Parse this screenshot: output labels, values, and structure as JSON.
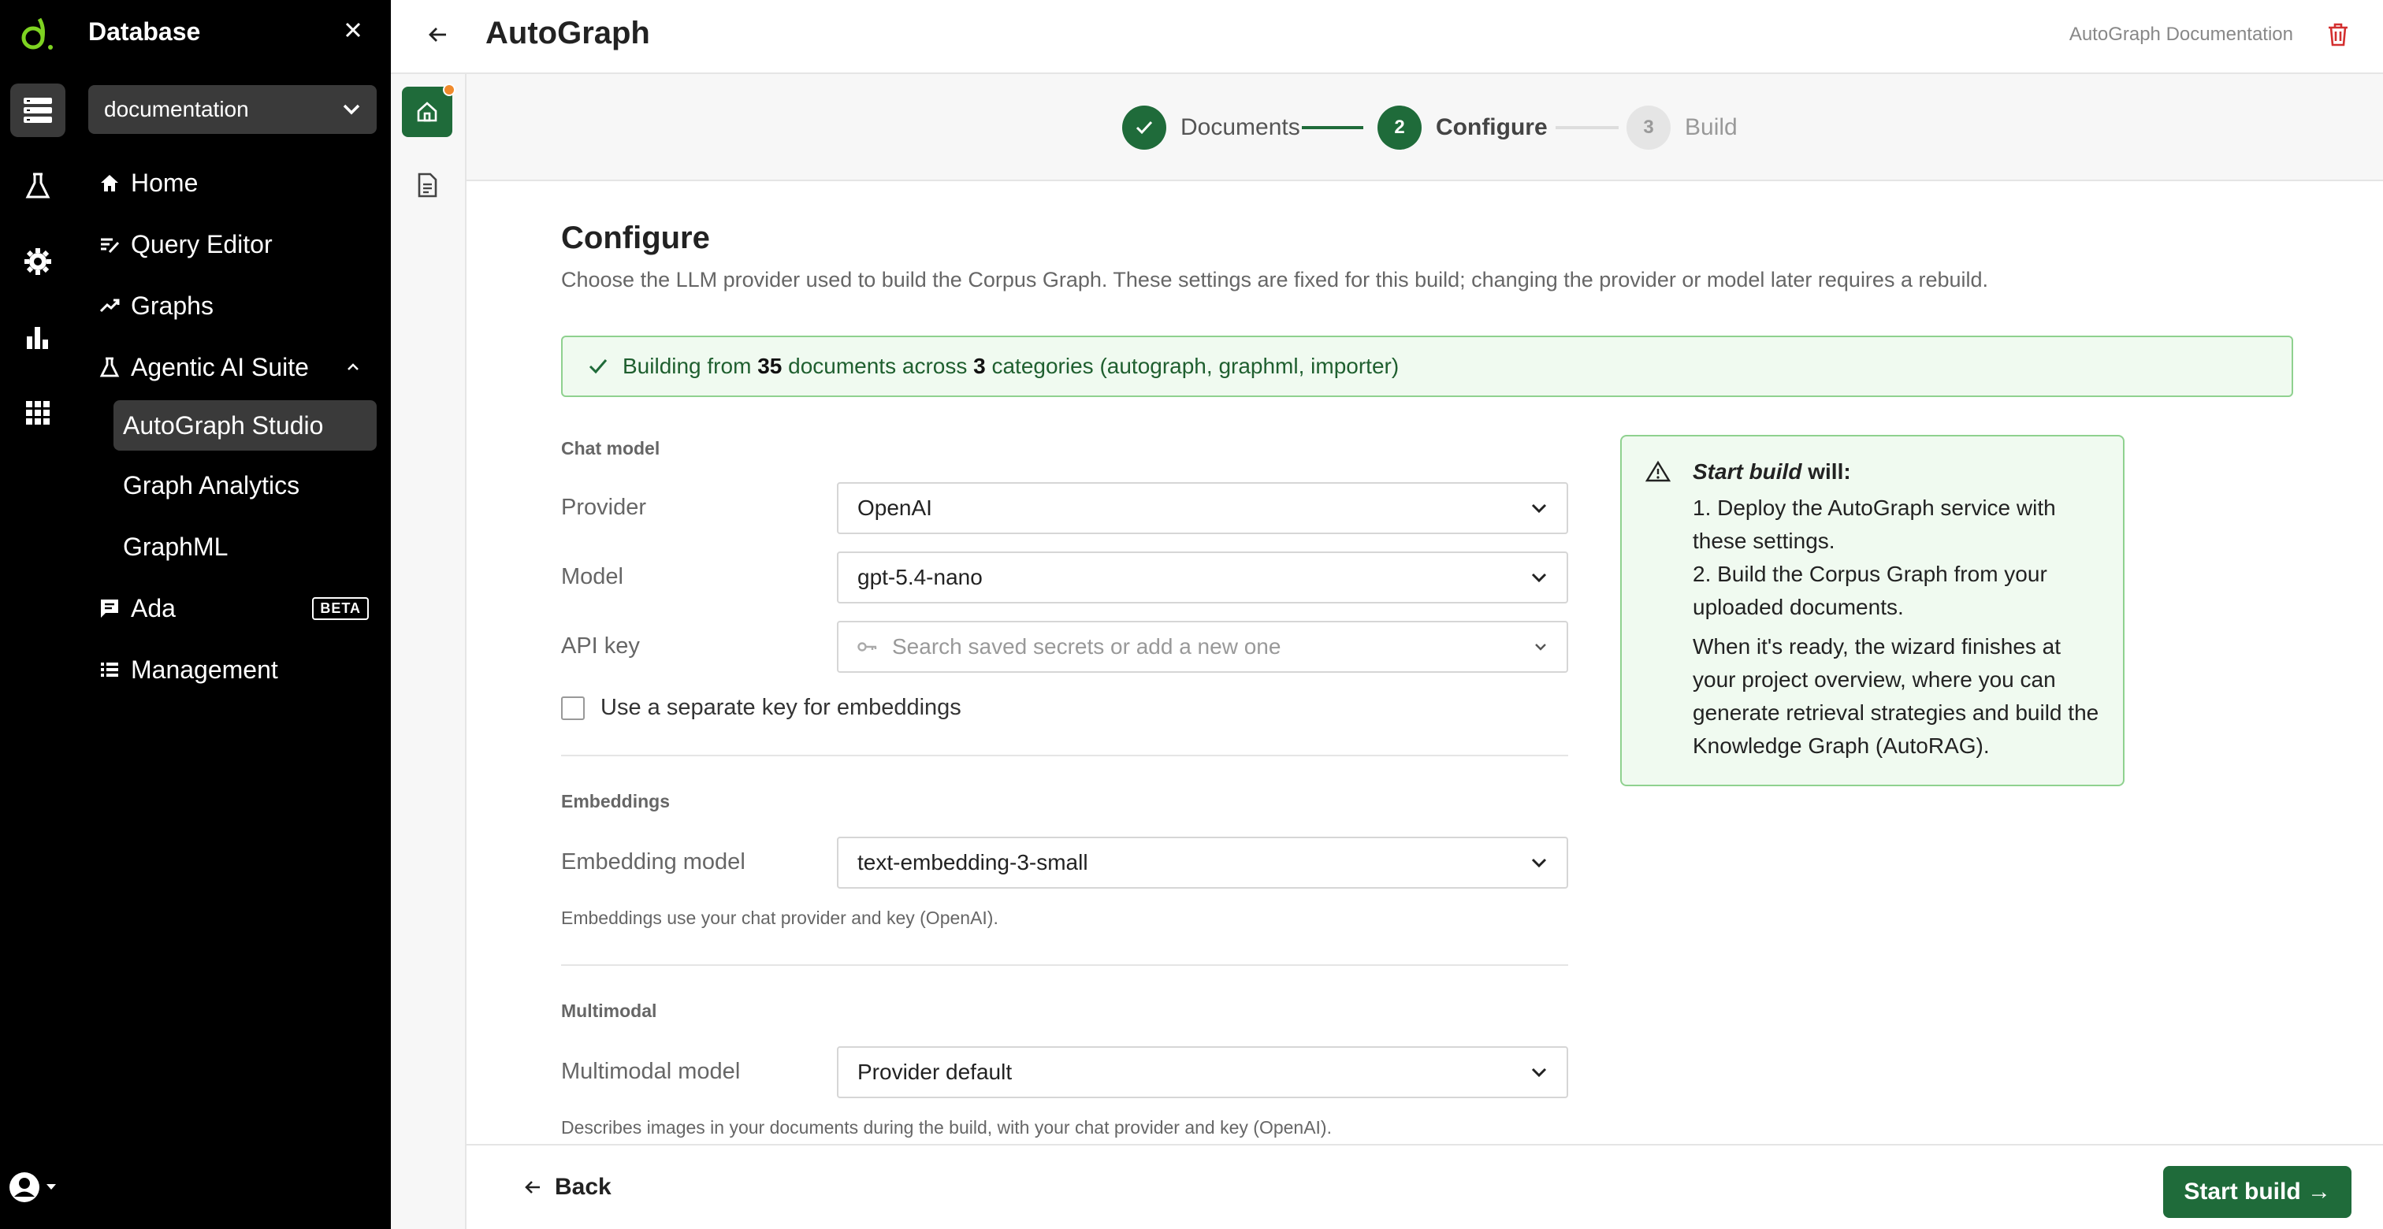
{
  "sidebar": {
    "title": "Database",
    "database": "documentation",
    "nav": [
      {
        "label": "Home",
        "icon": "home-icon"
      },
      {
        "label": "Query Editor",
        "icon": "query-editor-icon"
      },
      {
        "label": "Graphs",
        "icon": "graphs-icon"
      },
      {
        "label": "Agentic AI Suite",
        "icon": "flask-icon"
      },
      {
        "label": "AutoGraph Studio"
      },
      {
        "label": "Graph Analytics"
      },
      {
        "label": "GraphML"
      },
      {
        "label": "Ada",
        "icon": "chat-icon",
        "badge": "BETA"
      },
      {
        "label": "Management",
        "icon": "list-icon"
      }
    ]
  },
  "topbar": {
    "title": "AutoGraph",
    "doc_link": "AutoGraph Documentation"
  },
  "stepper": {
    "steps": [
      {
        "number": "✓",
        "label": "Documents",
        "state": "done"
      },
      {
        "number": "2",
        "label": "Configure",
        "state": "active"
      },
      {
        "number": "3",
        "label": "Build",
        "state": "pending"
      }
    ]
  },
  "main": {
    "heading": "Configure",
    "subtitle": "Choose the LLM provider used to build the Corpus Graph. These settings are fixed for this build; changing the provider or model later requires a rebuild.",
    "banner": {
      "prefix": "Building from",
      "doc_count": "35",
      "middle": "documents across",
      "cat_count": "3",
      "suffix": "categories (autograph, graphml, importer)"
    },
    "chat_model": {
      "section": "Chat model",
      "provider_label": "Provider",
      "provider_value": "OpenAI",
      "model_label": "Model",
      "model_value": "gpt-5.4-nano",
      "api_key_label": "API key",
      "api_key_placeholder": "Search saved secrets or add a new one",
      "separate_key_label": "Use a separate key for embeddings"
    },
    "embeddings": {
      "section": "Embeddings",
      "label": "Embedding model",
      "value": "text-embedding-3-small",
      "help": "Embeddings use your chat provider and key (OpenAI)."
    },
    "multimodal": {
      "section": "Multimodal",
      "label": "Multimodal model",
      "value": "Provider default",
      "help": "Describes images in your documents during the build, with your chat provider and key (OpenAI)."
    },
    "info_box": {
      "title_em": "Start build",
      "title_rest": "will:",
      "item1": "1. Deploy the AutoGraph service with these settings.",
      "item2": "2. Build the Corpus Graph from your uploaded documents.",
      "note": "When it's ready, the wizard finishes at your project overview, where you can generate retrieval strategies and build the Knowledge Graph (AutoRAG)."
    }
  },
  "footer": {
    "back_label": "Back",
    "start_label": "Start build →"
  },
  "colors": {
    "accent": "#1f6b3a",
    "banner_border": "#8fd18f",
    "notification": "#f08a2c",
    "danger": "#d32f2f"
  }
}
